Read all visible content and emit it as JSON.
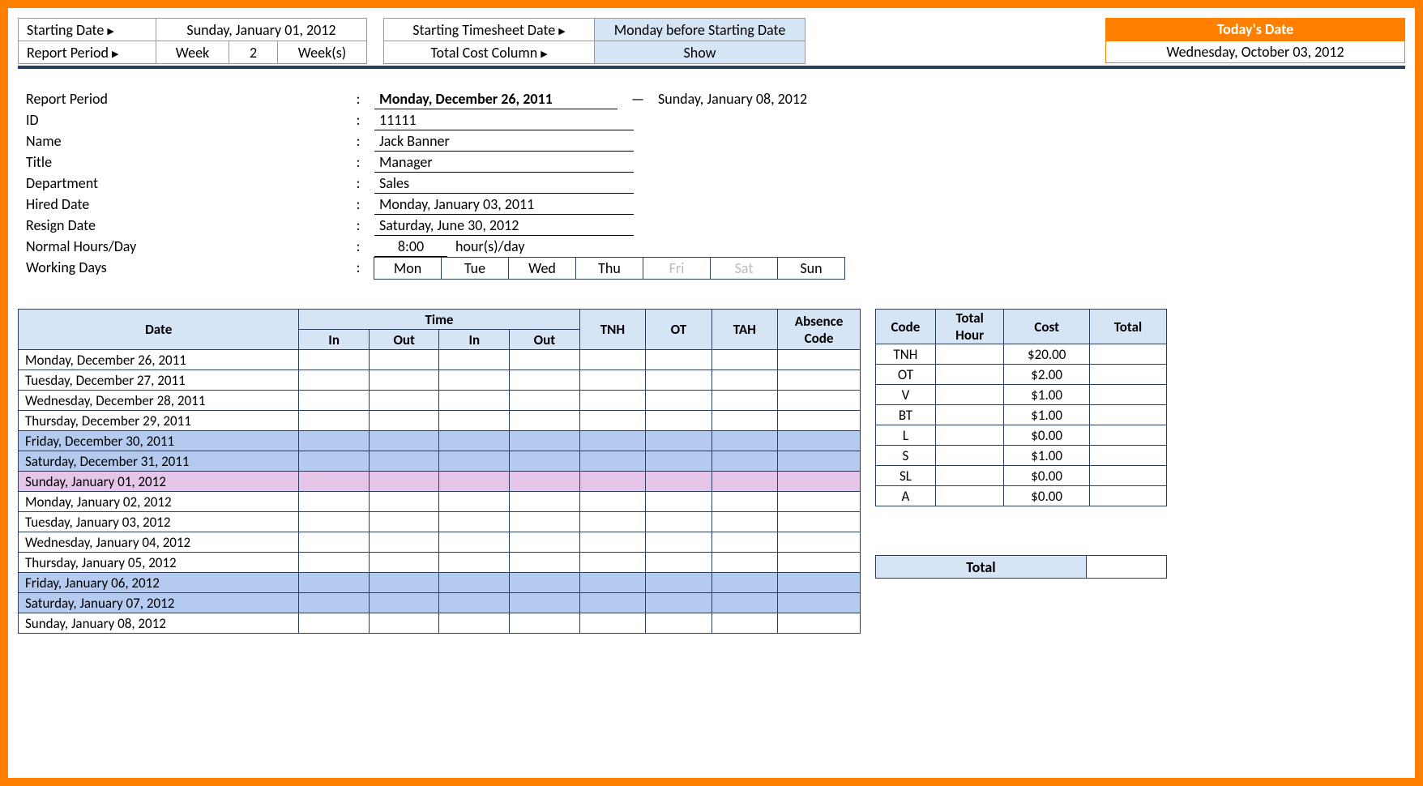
{
  "config": {
    "starting_date_label": "Starting Date",
    "starting_date_value": "Sunday, January 01, 2012",
    "report_period_label": "Report Period",
    "report_period_unit": "Week",
    "report_period_num": "2",
    "report_period_plural": "Week(s)",
    "starting_ts_label": "Starting Timesheet Date",
    "starting_ts_value": "Monday before Starting Date",
    "total_cost_col_label": "Total Cost Column",
    "total_cost_col_value": "Show"
  },
  "today": {
    "label": "Today's Date",
    "value": "Wednesday, October 03, 2012"
  },
  "info": {
    "report_period_label": "Report Period",
    "report_period_start": "Monday, December 26, 2011",
    "report_period_end": "Sunday, January 08, 2012",
    "id_label": "ID",
    "id_value": "11111",
    "name_label": "Name",
    "name_value": "Jack Banner",
    "title_label": "Title",
    "title_value": "Manager",
    "dept_label": "Department",
    "dept_value": "Sales",
    "hired_label": "Hired Date",
    "hired_value": "Monday, January 03, 2011",
    "resign_label": "Resign Date",
    "resign_value": "Saturday, June 30, 2012",
    "hours_label": "Normal Hours/Day",
    "hours_value": "8:00",
    "hours_unit": "hour(s)/day",
    "days_label": "Working Days",
    "days": [
      "Mon",
      "Tue",
      "Wed",
      "Thu",
      "Fri",
      "Sat",
      "Sun"
    ],
    "days_inactive": [
      false,
      false,
      false,
      false,
      true,
      true,
      false
    ]
  },
  "ts_headers": {
    "date": "Date",
    "time": "Time",
    "in": "In",
    "out": "Out",
    "tnh": "TNH",
    "ot": "OT",
    "tah": "TAH",
    "abs": "Absence Code"
  },
  "ts_rows": [
    {
      "date": "Monday, December 26, 2011",
      "cls": ""
    },
    {
      "date": "Tuesday, December 27, 2011",
      "cls": ""
    },
    {
      "date": "Wednesday, December 28, 2011",
      "cls": ""
    },
    {
      "date": "Thursday, December 29, 2011",
      "cls": ""
    },
    {
      "date": "Friday, December 30, 2011",
      "cls": "blue1"
    },
    {
      "date": "Saturday, December 31, 2011",
      "cls": "blue1"
    },
    {
      "date": "Sunday, January 01, 2012",
      "cls": "pink"
    },
    {
      "date": "Monday, January 02, 2012",
      "cls": ""
    },
    {
      "date": "Tuesday, January 03, 2012",
      "cls": ""
    },
    {
      "date": "Wednesday, January 04, 2012",
      "cls": ""
    },
    {
      "date": "Thursday, January 05, 2012",
      "cls": ""
    },
    {
      "date": "Friday, January 06, 2012",
      "cls": "blue1"
    },
    {
      "date": "Saturday, January 07, 2012",
      "cls": "blue1"
    },
    {
      "date": "Sunday, January 08, 2012",
      "cls": ""
    }
  ],
  "cost_headers": {
    "code": "Code",
    "hour": "Total Hour",
    "cost": "Cost",
    "total": "Total"
  },
  "cost_rows": [
    {
      "code": "TNH",
      "hour": "",
      "cost": "$20.00",
      "total": ""
    },
    {
      "code": "OT",
      "hour": "",
      "cost": "$2.00",
      "total": ""
    },
    {
      "code": "V",
      "hour": "",
      "cost": "$1.00",
      "total": ""
    },
    {
      "code": "BT",
      "hour": "",
      "cost": "$1.00",
      "total": ""
    },
    {
      "code": "L",
      "hour": "",
      "cost": "$0.00",
      "total": ""
    },
    {
      "code": "S",
      "hour": "",
      "cost": "$1.00",
      "total": ""
    },
    {
      "code": "SL",
      "hour": "",
      "cost": "$0.00",
      "total": ""
    },
    {
      "code": "A",
      "hour": "",
      "cost": "$0.00",
      "total": ""
    }
  ],
  "grand_total_label": "Total",
  "grand_total_value": ""
}
